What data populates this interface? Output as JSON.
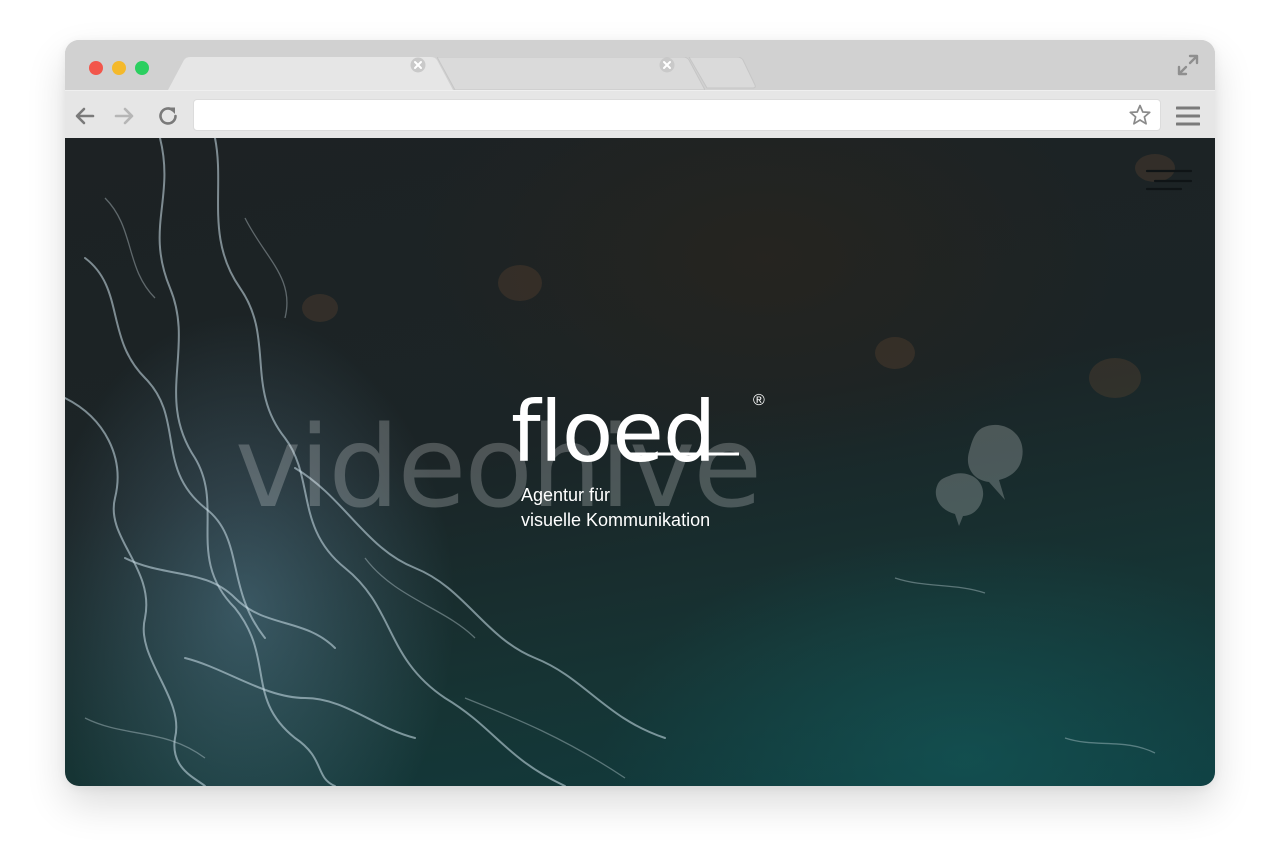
{
  "browser": {
    "tabs": [
      {
        "label": "",
        "active": true
      },
      {
        "label": "",
        "active": false
      }
    ],
    "address_bar": {
      "value": "",
      "placeholder": ""
    },
    "icons": [
      "back-arrow-icon",
      "forward-arrow-icon",
      "reload-icon",
      "star-icon",
      "menu-icon",
      "expand-icon",
      "tab-close-icon"
    ],
    "colors": {
      "close": "#f2564b",
      "minimize": "#f4b92b",
      "zoom": "#2bcf60",
      "chrome": "#d1d1d1",
      "toolbar": "#e6e6e6"
    }
  },
  "site": {
    "logo": "floed",
    "registered_mark": "®",
    "tagline_line1": "Agentur für",
    "tagline_line2": "visuelle Kommunikation",
    "menu_icon": "hamburger-menu-icon",
    "watermark": "videohive"
  }
}
